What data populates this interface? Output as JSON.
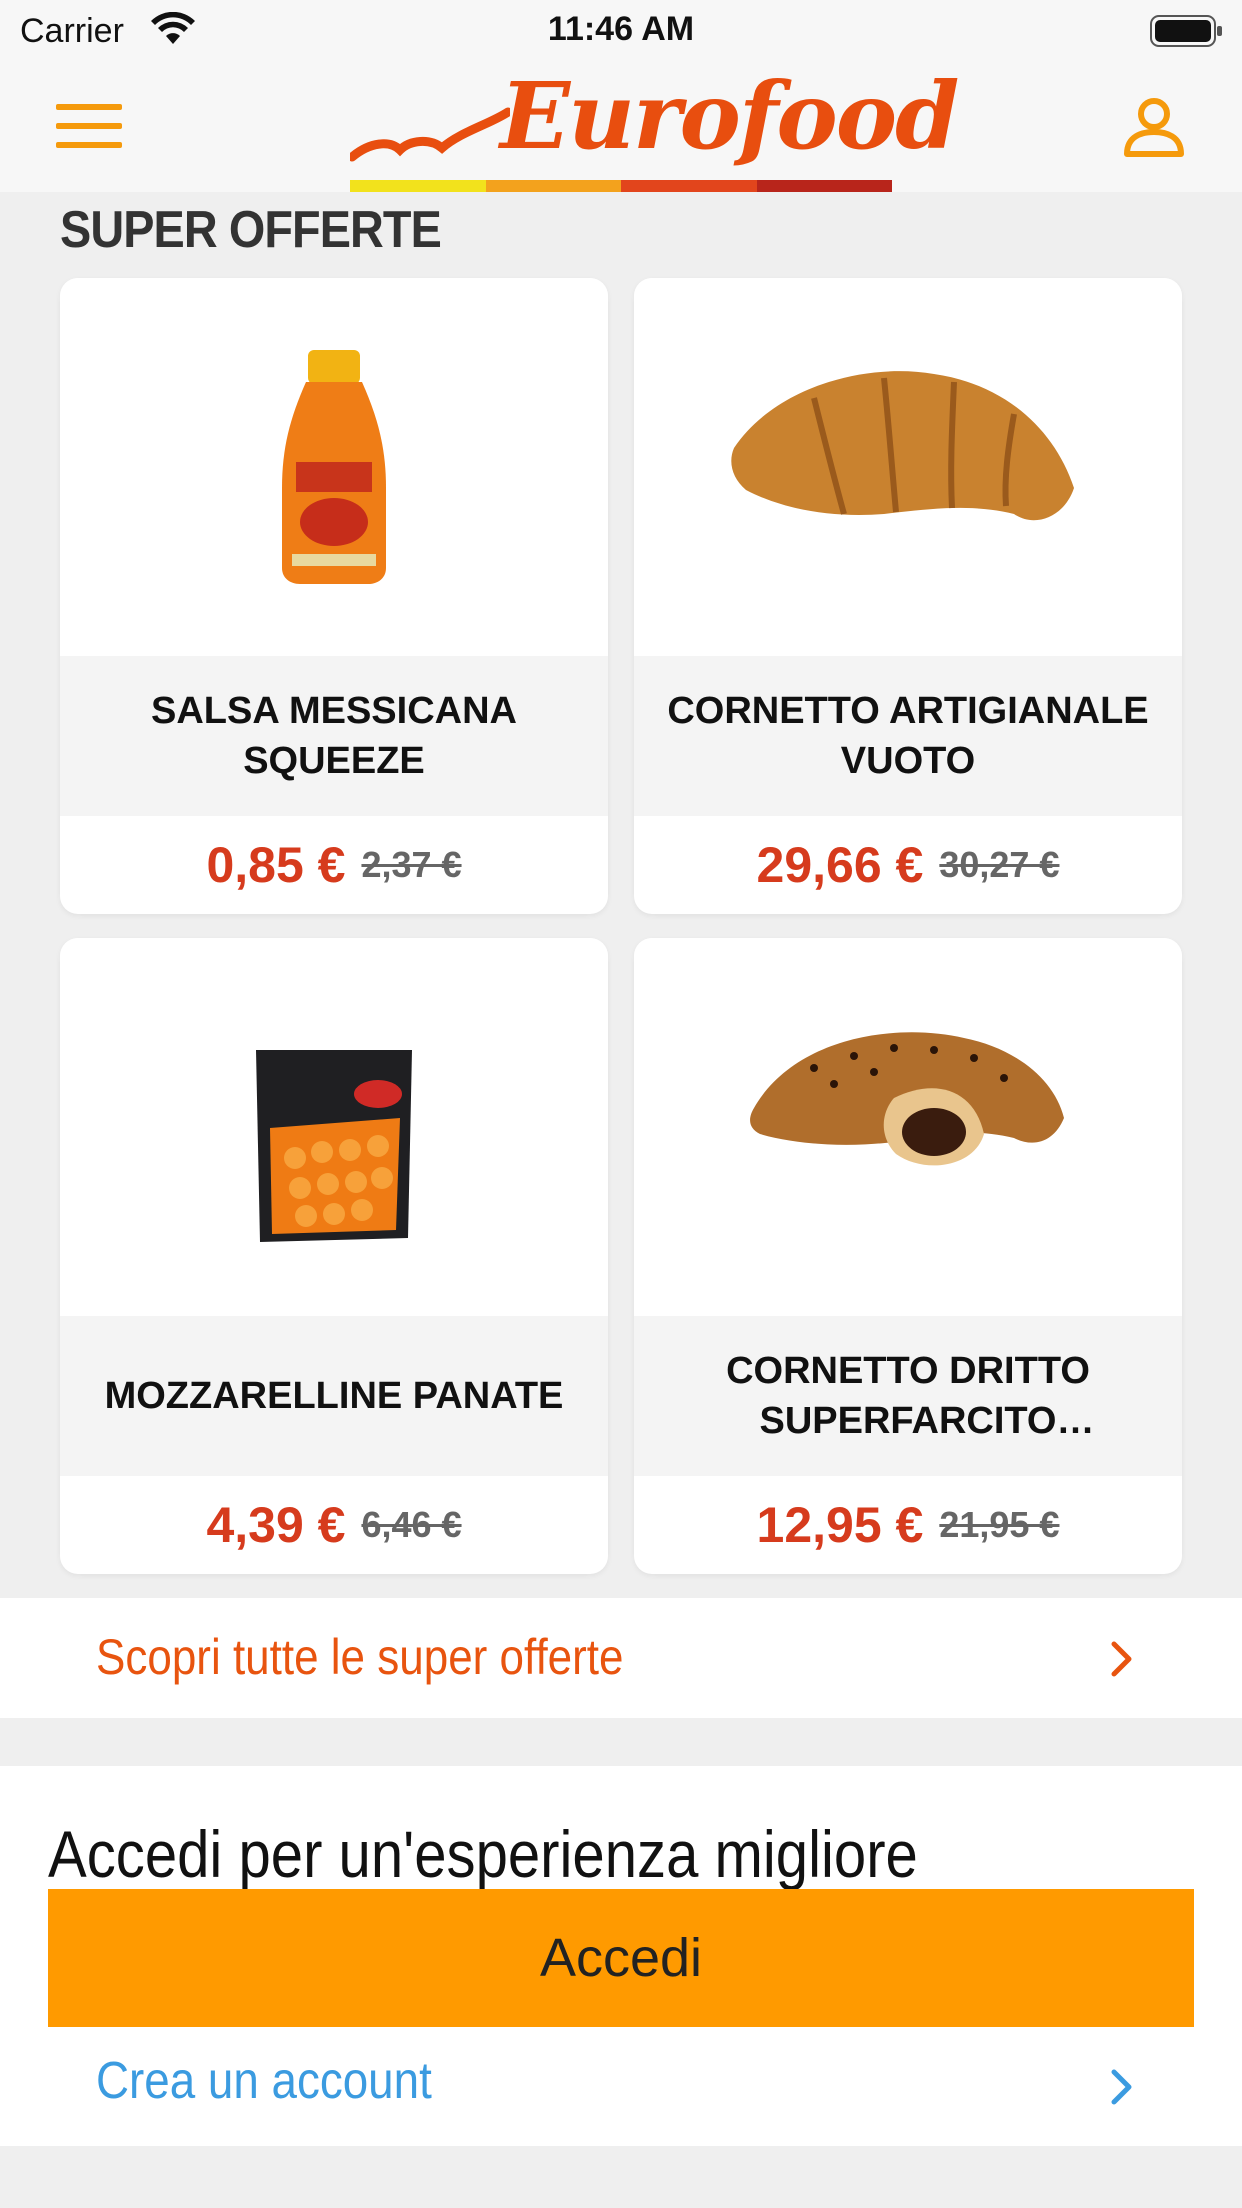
{
  "status_bar": {
    "carrier": "Carrier",
    "time": "11:46 AM"
  },
  "header": {
    "logo_text": "Eurofood",
    "logo_colors": [
      "#f2e21c",
      "#f3a21d",
      "#e2451c",
      "#b8251b"
    ]
  },
  "section": {
    "title": "SUPER OFFERTE"
  },
  "products": [
    {
      "name": "SALSA MESSICANA SQUEEZE",
      "price": "0,85 €",
      "old_price": "2,37 €",
      "image": "sauce-bottle"
    },
    {
      "name": "CORNETTO ARTIGIANALE VUOTO",
      "price": "29,66 €",
      "old_price": "30,27 €",
      "image": "croissant"
    },
    {
      "name": "MOZZARELLINE PANATE",
      "price": "4,39 €",
      "old_price": "6,46 €",
      "image": "breaded-mozzarella-bag"
    },
    {
      "name": "CORNETTO DRITTO SUPERFARCITO NOCCIOLA",
      "price": "12,95 €",
      "old_price": "21,95 €",
      "image": "chocolate-croissant"
    }
  ],
  "all_offers_link": {
    "label": "Scopri tutte le super offerte"
  },
  "login": {
    "title": "Accedi per un'esperienza migliore",
    "button_label": "Accedi",
    "create_account_label": "Crea un account"
  },
  "colors": {
    "accent_orange": "#ff9a00",
    "link_orange": "#e8540f",
    "price_red": "#d63b1d",
    "link_blue": "#3b9be0"
  }
}
